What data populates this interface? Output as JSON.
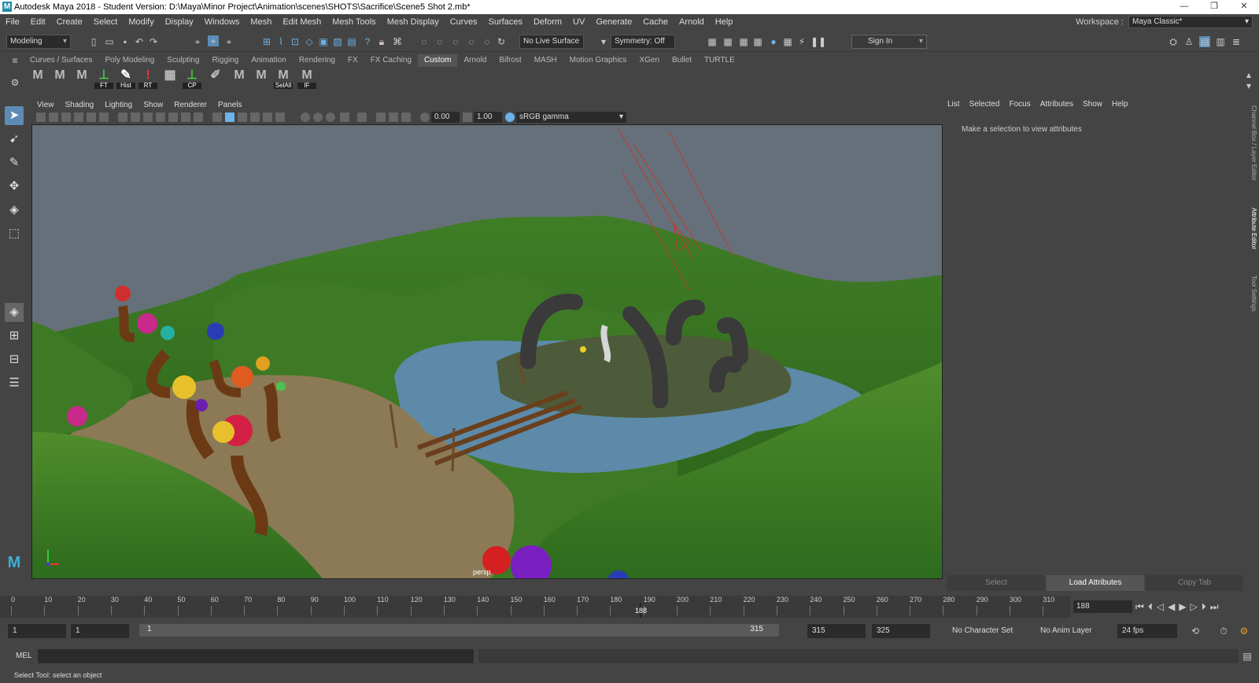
{
  "window": {
    "title": "Autodesk Maya 2018 - Student Version: D:\\Maya\\Minor Project\\Animation\\scenes\\SHOTS\\Sacrifice\\Scene5 Shot 2.mb*",
    "logo": "M",
    "minimize": "—",
    "maximize": "❐",
    "close": "✕"
  },
  "menu": [
    "File",
    "Edit",
    "Create",
    "Select",
    "Modify",
    "Display",
    "Windows",
    "Mesh",
    "Edit Mesh",
    "Mesh Tools",
    "Mesh Display",
    "Curves",
    "Surfaces",
    "Deform",
    "UV",
    "Generate",
    "Cache",
    "Arnold",
    "Help"
  ],
  "workspace": {
    "label": "Workspace :",
    "value": "Maya Classic*"
  },
  "statusline": {
    "menuset": "Modeling",
    "live_surface": "No Live Surface",
    "symmetry": "Symmetry: Off",
    "sign_in": "Sign In"
  },
  "shelf": {
    "tabs": [
      "Curves / Surfaces",
      "Poly Modeling",
      "Sculpting",
      "Rigging",
      "Animation",
      "Rendering",
      "FX",
      "FX Caching",
      "Custom",
      "Arnold",
      "Bifrost",
      "MASH",
      "Motion Graphics",
      "XGen",
      "Bullet",
      "TURTLE"
    ],
    "active_tab": "Custom",
    "buttons": [
      {
        "glyph": "M",
        "label": ""
      },
      {
        "glyph": "M",
        "label": ""
      },
      {
        "glyph": "M",
        "label": ""
      },
      {
        "glyph": "⊥",
        "label": "FT"
      },
      {
        "glyph": "✎",
        "label": "Hist"
      },
      {
        "glyph": "!",
        "label": "RT"
      },
      {
        "glyph": "▦",
        "label": ""
      },
      {
        "glyph": "⊥",
        "label": "CP"
      },
      {
        "glyph": "✐",
        "label": ""
      },
      {
        "glyph": "M",
        "label": ""
      },
      {
        "glyph": "M",
        "label": ""
      },
      {
        "glyph": "M",
        "label": "SelAll"
      },
      {
        "glyph": "M",
        "label": "IF"
      }
    ]
  },
  "panel_menu": [
    "View",
    "Shading",
    "Lighting",
    "Show",
    "Renderer",
    "Panels"
  ],
  "panel_toolbar": {
    "exposure": "0.00",
    "gamma": "1.00",
    "color_space": "sRGB gamma"
  },
  "viewport": {
    "camera": "persp"
  },
  "attribute_editor": {
    "menu": [
      "List",
      "Selected",
      "Focus",
      "Attributes",
      "Show",
      "Help"
    ],
    "message": "Make a selection to view attributes",
    "buttons": [
      "Select",
      "Load Attributes",
      "Copy Tab"
    ]
  },
  "side_tabs": [
    "Channel Box / Layer Editor",
    "Attribute Editor",
    "Tool Settings"
  ],
  "timeline": {
    "ticks": [
      "0",
      "10",
      "20",
      "30",
      "40",
      "50",
      "60",
      "70",
      "80",
      "90",
      "100",
      "110",
      "120",
      "130",
      "140",
      "150",
      "160",
      "170",
      "180",
      "190",
      "200",
      "210",
      "220",
      "230",
      "240",
      "250",
      "260",
      "270",
      "280",
      "290",
      "300",
      "310"
    ],
    "current_frame": "188",
    "current_frame_field": "188"
  },
  "range": {
    "start": "1",
    "playback_start": "1",
    "slider_start": "1",
    "slider_end": "315",
    "playback_end": "315",
    "end": "325",
    "character_set": "No Character Set",
    "anim_layer": "No Anim Layer",
    "fps": "24 fps"
  },
  "command_line": {
    "label": "MEL"
  },
  "help_line": "Select Tool: select an object"
}
